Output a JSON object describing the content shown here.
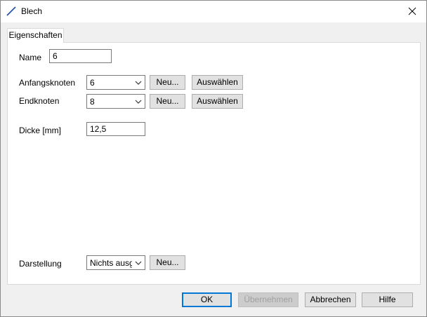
{
  "window": {
    "title": "Blech",
    "icon": "line-icon",
    "close_icon": "close-icon"
  },
  "tabs": [
    {
      "label": "Eigenschaften",
      "active": true
    }
  ],
  "form": {
    "name_label": "Name",
    "name_value": "6",
    "start_node_label": "Anfangsknoten",
    "start_node_value": "6",
    "end_node_label": "Endknoten",
    "end_node_value": "8",
    "new_label": "Neu...",
    "select_label": "Auswählen",
    "thickness_label": "Dicke [mm]",
    "thickness_value": "12,5",
    "display_label": "Darstellung",
    "display_value": "Nichts ausgewählt",
    "display_new_label": "Neu..."
  },
  "footer": {
    "ok_label": "OK",
    "apply_label": "Übernehmen",
    "cancel_label": "Abbrechen",
    "help_label": "Hilfe"
  },
  "colors": {
    "accent": "#0078d7",
    "line_icon": "#1e4fa0"
  }
}
